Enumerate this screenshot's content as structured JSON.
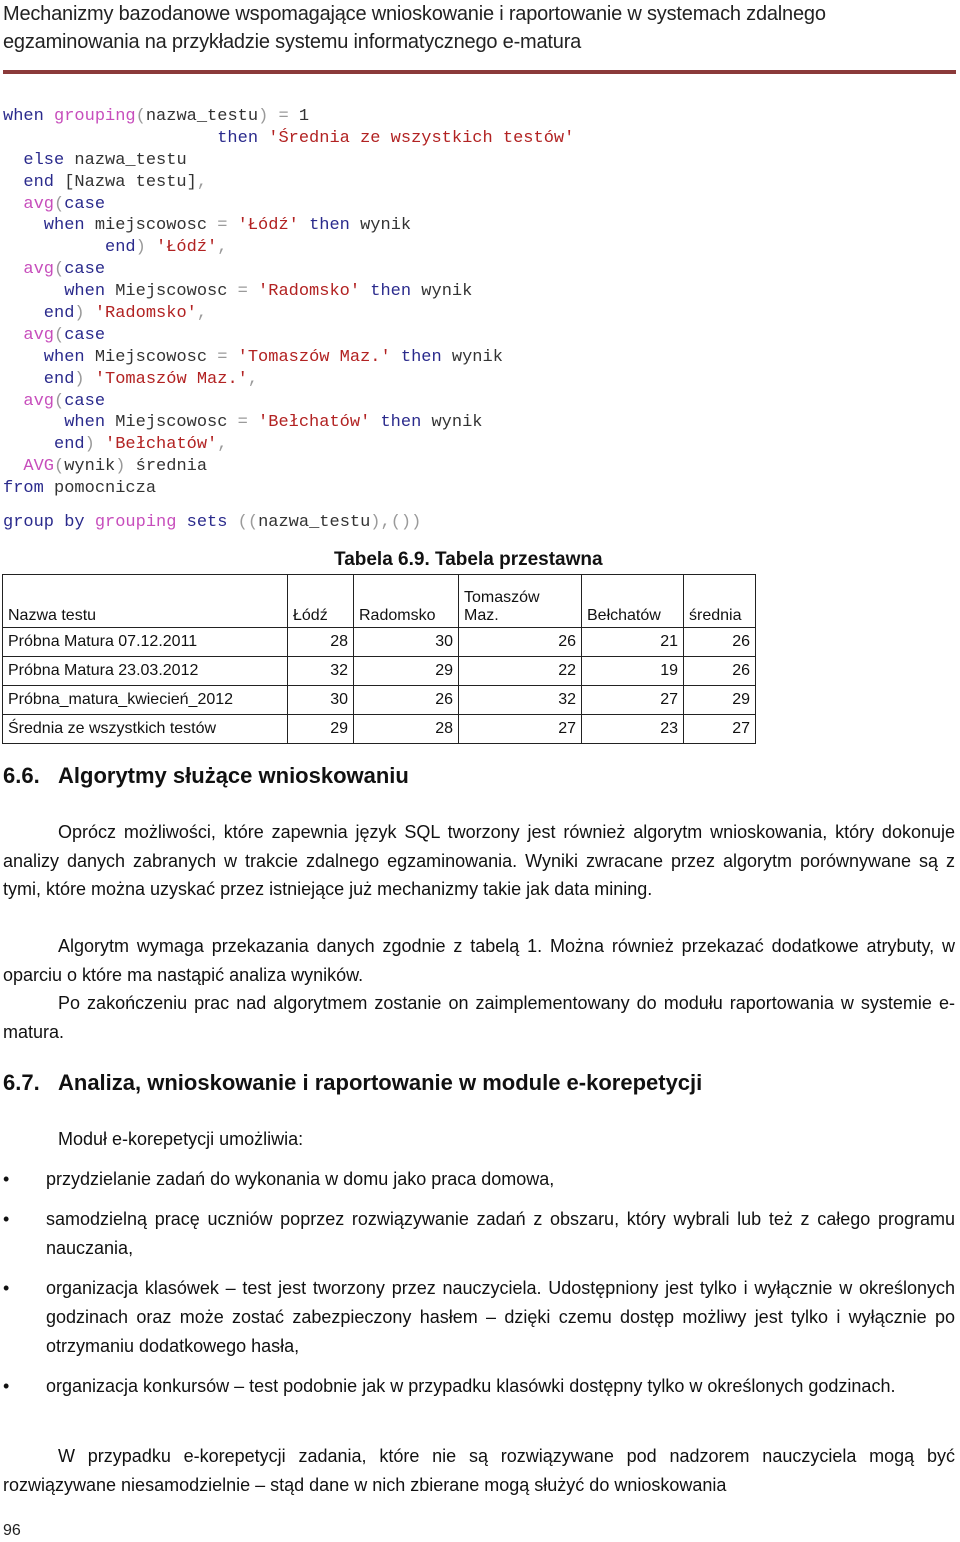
{
  "header": {
    "title_line1": "Mechanizmy bazodanowe wspomagające wnioskowanie i raportowanie w systemach zdalnego",
    "title_line2": "egzaminowania na przykładzie systemu informatycznego e-matura",
    "rule_color": "#8b3a3a"
  },
  "code": {
    "lines": [
      [
        {
          "t": "when ",
          "c": "kw"
        },
        {
          "t": "grouping",
          "c": "fn"
        },
        {
          "t": "(",
          "c": "op"
        },
        {
          "t": "nazwa_testu",
          "c": "id"
        },
        {
          "t": ") = ",
          "c": "op"
        },
        {
          "t": "1",
          "c": "id"
        }
      ],
      [
        {
          "t": "                     then ",
          "c": "kw"
        },
        {
          "t": "'Średnia ze wszystkich testów'",
          "c": "str"
        }
      ],
      [
        {
          "t": "  else ",
          "c": "kw"
        },
        {
          "t": "nazwa_testu",
          "c": "id"
        }
      ],
      [
        {
          "t": "  end ",
          "c": "kw"
        },
        {
          "t": "[Nazwa testu]",
          "c": "id"
        },
        {
          "t": ",",
          "c": "op"
        }
      ],
      [
        {
          "t": "  avg",
          "c": "fn"
        },
        {
          "t": "(",
          "c": "op"
        },
        {
          "t": "case",
          "c": "kw"
        }
      ],
      [
        {
          "t": "    when ",
          "c": "kw"
        },
        {
          "t": "miejscowosc ",
          "c": "id"
        },
        {
          "t": "= ",
          "c": "op"
        },
        {
          "t": "'Łódź'",
          "c": "str"
        },
        {
          "t": " then ",
          "c": "kw"
        },
        {
          "t": "wynik",
          "c": "id"
        }
      ],
      [
        {
          "t": "          end",
          "c": "kw"
        },
        {
          "t": ") ",
          "c": "op"
        },
        {
          "t": "'Łódź'",
          "c": "str"
        },
        {
          "t": ",",
          "c": "op"
        }
      ],
      [
        {
          "t": "  avg",
          "c": "fn"
        },
        {
          "t": "(",
          "c": "op"
        },
        {
          "t": "case",
          "c": "kw"
        }
      ],
      [
        {
          "t": "      when ",
          "c": "kw"
        },
        {
          "t": "Miejscowosc ",
          "c": "id"
        },
        {
          "t": "= ",
          "c": "op"
        },
        {
          "t": "'Radomsko'",
          "c": "str"
        },
        {
          "t": " then ",
          "c": "kw"
        },
        {
          "t": "wynik",
          "c": "id"
        }
      ],
      [
        {
          "t": "    end",
          "c": "kw"
        },
        {
          "t": ") ",
          "c": "op"
        },
        {
          "t": "'Radomsko'",
          "c": "str"
        },
        {
          "t": ",",
          "c": "op"
        }
      ],
      [
        {
          "t": "  avg",
          "c": "fn"
        },
        {
          "t": "(",
          "c": "op"
        },
        {
          "t": "case",
          "c": "kw"
        }
      ],
      [
        {
          "t": "    when ",
          "c": "kw"
        },
        {
          "t": "Miejscowosc ",
          "c": "id"
        },
        {
          "t": "= ",
          "c": "op"
        },
        {
          "t": "'Tomaszów Maz.'",
          "c": "str"
        },
        {
          "t": " then ",
          "c": "kw"
        },
        {
          "t": "wynik",
          "c": "id"
        }
      ],
      [
        {
          "t": "    end",
          "c": "kw"
        },
        {
          "t": ") ",
          "c": "op"
        },
        {
          "t": "'Tomaszów Maz.'",
          "c": "str"
        },
        {
          "t": ",",
          "c": "op"
        }
      ],
      [
        {
          "t": "  avg",
          "c": "fn"
        },
        {
          "t": "(",
          "c": "op"
        },
        {
          "t": "case",
          "c": "kw"
        }
      ],
      [
        {
          "t": "      when ",
          "c": "kw"
        },
        {
          "t": "Miejscowosc ",
          "c": "id"
        },
        {
          "t": "= ",
          "c": "op"
        },
        {
          "t": "'Bełchatów'",
          "c": "str"
        },
        {
          "t": " then ",
          "c": "kw"
        },
        {
          "t": "wynik",
          "c": "id"
        }
      ],
      [
        {
          "t": "     end",
          "c": "kw"
        },
        {
          "t": ") ",
          "c": "op"
        },
        {
          "t": "'Bełchatów'",
          "c": "str"
        },
        {
          "t": ",",
          "c": "op"
        }
      ],
      [
        {
          "t": "  AVG",
          "c": "fn"
        },
        {
          "t": "(",
          "c": "op"
        },
        {
          "t": "wynik",
          "c": "id"
        },
        {
          "t": ") ",
          "c": "op"
        },
        {
          "t": "średnia",
          "c": "id"
        }
      ],
      [
        {
          "t": "from ",
          "c": "kw"
        },
        {
          "t": "pomocnicza",
          "c": "id"
        }
      ],
      [],
      [
        {
          "t": "group by ",
          "c": "kw"
        },
        {
          "t": "grouping",
          "c": "fn"
        },
        {
          "t": " sets ",
          "c": "kw"
        },
        {
          "t": "((",
          "c": "op"
        },
        {
          "t": "nazwa_testu",
          "c": "id"
        },
        {
          "t": "),())",
          "c": "op"
        }
      ]
    ]
  },
  "table": {
    "caption": "Tabela 6.9. Tabela przestawna",
    "headers": [
      "Nazwa testu",
      "Łódź",
      "Radomsko",
      "Tomaszów Maz.",
      "Bełchatów",
      "średnia"
    ],
    "rows": [
      [
        "Próbna Matura 07.12.2011",
        "28",
        "30",
        "26",
        "21",
        "26"
      ],
      [
        "Próbna Matura 23.03.2012",
        "32",
        "29",
        "22",
        "19",
        "26"
      ],
      [
        "Próbna_matura_kwiecień_2012",
        "30",
        "26",
        "32",
        "27",
        "29"
      ],
      [
        "Średnia ze wszystkich testów",
        "29",
        "28",
        "27",
        "23",
        "27"
      ]
    ]
  },
  "section_66": {
    "number": "6.6.",
    "title": "Algorytmy służące wnioskowaniu",
    "p1": "Oprócz możliwości, które zapewnia język SQL tworzony jest również algorytm wnioskowania, który dokonuje analizy danych zabranych w trakcie zdalnego egzaminowania. Wyniki zwracane przez algorytm porównywane są z tymi, które można uzyskać przez istniejące już mechanizmy takie jak data mining.",
    "p2": "Algorytm wymaga przekazania danych zgodnie z tabelą 1. Można również przekazać dodatkowe atrybuty, w oparciu o które ma nastąpić analiza wyników.",
    "p3": "Po zakończeniu prac nad algorytmem zostanie on zaimplementowany do modułu raportowania w systemie e-matura."
  },
  "section_67": {
    "number": "6.7.",
    "title": "Analiza, wnioskowanie i raportowanie w module e-korepetycji",
    "intro": "Moduł e-korepetycji umożliwia:",
    "bullets": [
      "przydzielanie zadań do wykonania w domu jako praca domowa,",
      "samodzielną pracę uczniów poprzez rozwiązywanie zadań z obszaru, który wybrali lub też z całego programu nauczania,",
      "organizacja klasówek – test jest tworzony przez nauczyciela. Udostępniony jest tylko i wyłącznie w określonych godzinach oraz może zostać zabezpieczony hasłem – dzięki czemu dostęp możliwy jest tylko i wyłącznie po otrzymaniu dodatkowego hasła,",
      "organizacja konkursów – test podobnie jak w przypadku klasówki dostępny tylko w określonych godzinach."
    ],
    "bullet_glyph": "•",
    "closing": "W przypadku e-korepetycji zadania, które nie są rozwiązywane pod nadzorem nauczyciela mogą być rozwiązywane niesamodzielnie – stąd dane w nich zbierane mogą służyć do wnioskowania"
  },
  "page_number": "96"
}
